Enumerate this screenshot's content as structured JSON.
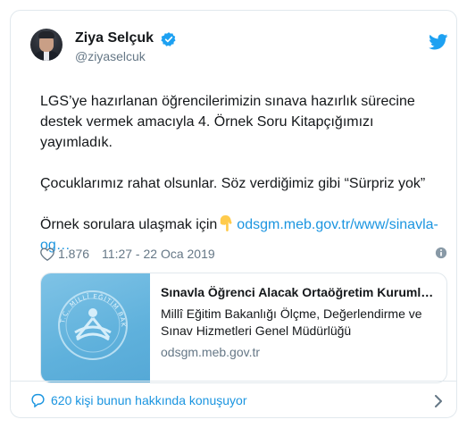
{
  "user": {
    "name": "Ziya Selçuk",
    "handle": "@ziyaselcuk"
  },
  "tweet": {
    "line1": "LGS’ye hazırlanan öğrencilerimizin sınava hazırlık sürecine",
    "line2": "destek vermek amacıyla 4. Örnek Soru Kitapçığımızı",
    "line3": "yayımladık.",
    "line4": "Çocuklarımız rahat olsunlar. Söz verdiğimiz gibi “Sürpriz yok”",
    "line5_prefix": "Örnek sorulara ulaşmak için",
    "line5_link": "odsgm.meb.gov.tr/www/sinavla-",
    "line6_link": "og…"
  },
  "meta": {
    "likes": "1.876",
    "timestamp": "11:27 - 22 Oca 2019"
  },
  "link_card": {
    "title": "Sınavla Öğrenci Alacak Ortaöğretim Kurumları...",
    "description": "Millî Eğitim Bakanlığı Ölçme, Değerlendirme ve Sınav Hizmetleri Genel Müdürlüğü",
    "domain": "odsgm.meb.gov.tr",
    "thumb_caption": "T.C. MİLLÎ EĞİTİM BAKANLIĞI"
  },
  "footer": {
    "conversation_text": "620 kişi bunun hakkında konuşuyor"
  },
  "colors": {
    "link": "#1b95e0",
    "secondary_text": "#657786",
    "border": "#e1e8ed"
  },
  "icons": [
    "verified-icon",
    "twitter-bird-icon",
    "pointing-down-emoji",
    "heart-icon",
    "info-icon",
    "meb-logo",
    "comment-icon",
    "chevron-right-icon"
  ]
}
